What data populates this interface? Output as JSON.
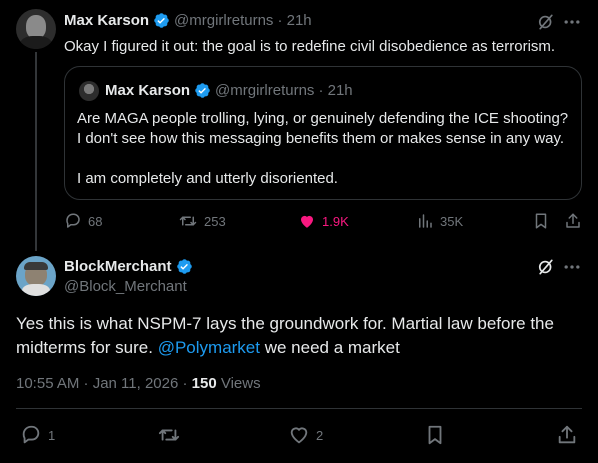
{
  "parent_tweet": {
    "author_name": "Max Karson",
    "handle": "@mrgirlreturns",
    "time": "· 21h",
    "text": "Okay I figured it out: the goal is to redefine civil disobedience as terrorism.",
    "quoted": {
      "author_name": "Max Karson",
      "handle": "@mrgirlreturns",
      "time": "· 21h",
      "text_line1": "Are MAGA people trolling, lying, or genuinely defending the ICE shooting?",
      "text_line2": "I don't see how this messaging benefits them or makes sense in any way.",
      "text_line3": "I am completely and utterly disoriented."
    },
    "actions": {
      "replies": "68",
      "reposts": "253",
      "likes": "1.9K",
      "views": "35K"
    }
  },
  "reply_tweet": {
    "author_name": "BlockMerchant",
    "handle": "@Block_Merchant",
    "text_before": "Yes this is what NSPM-7 lays the groundwork for. Martial law before the midterms for sure. ",
    "mention": "@Polymarket",
    "text_after": " we need a market",
    "timestamp": "10:55 AM · Jan 11, 2026 · ",
    "views_count": "150",
    "views_label": " Views",
    "actions": {
      "replies": "1",
      "likes": "2"
    }
  },
  "icons": {
    "verified": "verified-badge-icon",
    "grok": "grok-icon",
    "more": "more-icon",
    "reply": "reply-icon",
    "repost": "repost-icon",
    "like": "heart-icon",
    "views": "views-icon",
    "bookmark": "bookmark-icon",
    "share": "share-icon"
  },
  "colors": {
    "background": "#000000",
    "text": "#e7e9ea",
    "muted": "#71767b",
    "accent": "#1d9bf0",
    "like": "#f91880",
    "border": "#2f3336"
  }
}
